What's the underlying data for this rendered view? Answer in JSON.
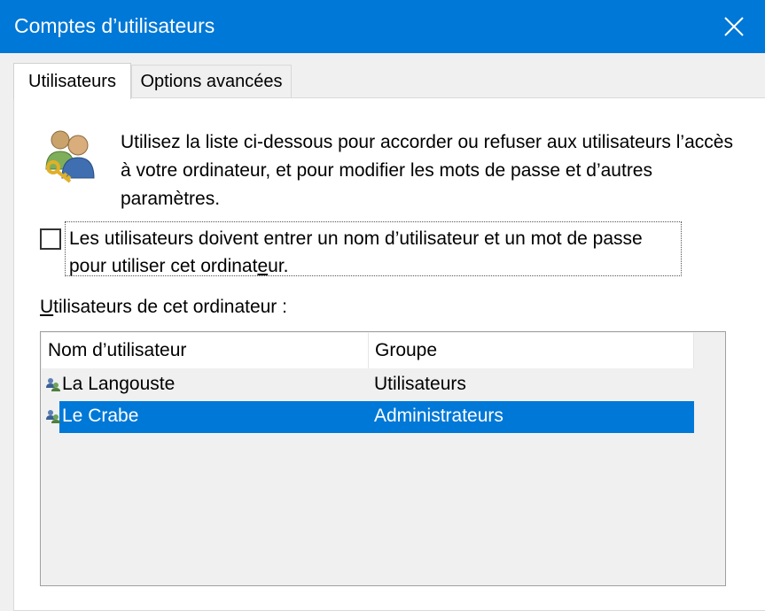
{
  "window": {
    "title": "Comptes d’utilisateurs"
  },
  "tabs": [
    {
      "label": "Utilisateurs",
      "active": true
    },
    {
      "label": "Options avancées",
      "active": false
    }
  ],
  "intro": {
    "icon": "users-key-icon",
    "text": "Utilisez la liste ci-dessous pour accorder ou refuser aux utilisateurs l’accès à votre ordinateur, et pour modifier les mots de passe et d’autres paramètres."
  },
  "require_login": {
    "checked": false,
    "label_before": "Les utilisateurs doivent entrer un nom d’utilisateur et un mot de passe pour utiliser cet ordinat",
    "label_mnemonic": "e",
    "label_after": "ur."
  },
  "users_section": {
    "label_mnemonic": "U",
    "label_rest": "tilisateurs de cet ordinateur :"
  },
  "users_table": {
    "columns": [
      "Nom d’utilisateur",
      "Groupe"
    ],
    "rows": [
      {
        "name": "La Langouste",
        "group": "Utilisateurs",
        "icon": "user-account-icon",
        "selected": false
      },
      {
        "name": "Le Crabe",
        "group": "Administrateurs",
        "icon": "user-account-icon",
        "selected": true
      }
    ]
  },
  "colors": {
    "titlebar": "#0078d7",
    "selection": "#0078d7",
    "background": "#f0f0f0"
  }
}
